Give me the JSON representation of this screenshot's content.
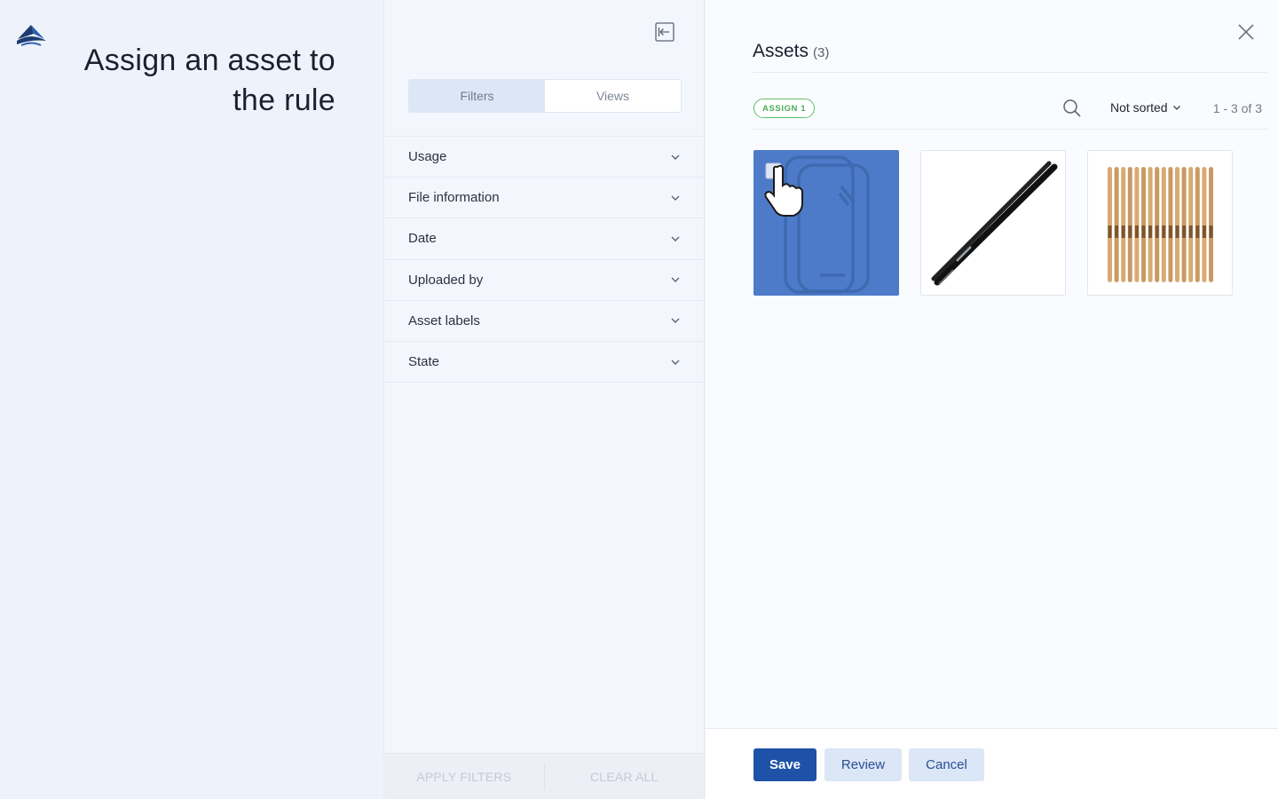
{
  "page": {
    "title": "Assign an asset to the rule"
  },
  "filters_panel": {
    "tabs": [
      {
        "label": "Filters",
        "active": true
      },
      {
        "label": "Views",
        "active": false
      }
    ],
    "items": [
      {
        "label": "Usage"
      },
      {
        "label": "File information"
      },
      {
        "label": "Date"
      },
      {
        "label": "Uploaded by"
      },
      {
        "label": "Asset labels"
      },
      {
        "label": "State"
      }
    ],
    "footer": {
      "apply_label": "APPLY FILTERS",
      "clear_label": "CLEAR ALL"
    }
  },
  "assets_panel": {
    "title": "Assets",
    "count": "(3)",
    "assign_badge": "ASSIGN 1",
    "sort_label": "Not sorted",
    "paging": "1 - 3 of 3",
    "assets": [
      {
        "type": "generic-file",
        "selected": true
      },
      {
        "type": "drumstick-image",
        "selected": false
      },
      {
        "type": "drumsticks-bundle-image",
        "selected": false
      }
    ],
    "footer": {
      "save_label": "Save",
      "review_label": "Review",
      "cancel_label": "Cancel"
    }
  },
  "colors": {
    "accent": "#1e52a8",
    "selected_tile": "#4d7bc9",
    "assign_green": "#4aad57"
  }
}
